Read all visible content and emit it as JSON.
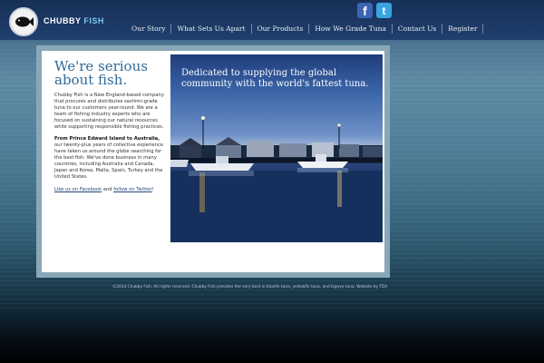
{
  "brand": {
    "name_part1": "CHUBBY",
    "name_part2": "FISH"
  },
  "social": {
    "facebook_glyph": "f",
    "twitter_glyph": "t"
  },
  "nav": [
    {
      "label": "Our Story"
    },
    {
      "label": "What Sets Us Apart"
    },
    {
      "label": "Our Products"
    },
    {
      "label": "How We Grade Tuna"
    },
    {
      "label": "Contact Us"
    },
    {
      "label": "Register"
    }
  ],
  "content": {
    "headline": "We're serious about fish.",
    "intro": "Chubby Fish is a New England-based company that procures and distributes sashimi-grade tuna to our customers year-round. We are a team of fishing industry experts who are focused on sustaining our natural resources while supporting responsible fishing practices.",
    "reach_bold": "From Prince Edward Island to Australia,",
    "reach_text": " our twenty-plus years of collective experience have taken us around the globe searching for the best fish. We've done business in many countries, including Australia and Canada, Japan and Korea, Malta, Spain, Turkey and the United States.",
    "facebook_link": "Like us on Facebook",
    "and_text": " and ",
    "twitter_link": "follow on Twitter",
    "exclaim": "!"
  },
  "hero": {
    "caption": "Dedicated to supplying the global community with the world's fattest tuna."
  },
  "footer": {
    "text": "©2014 Chubby Fish. All rights reserved. Chubby Fish provides the very best in bluefin tuna, yellowfin tuna, and bigeye tuna. Website by TDA"
  },
  "colors": {
    "accent": "#2f6b9a",
    "header": "#1f3e6a",
    "panel_border": "#8aa7b8"
  }
}
